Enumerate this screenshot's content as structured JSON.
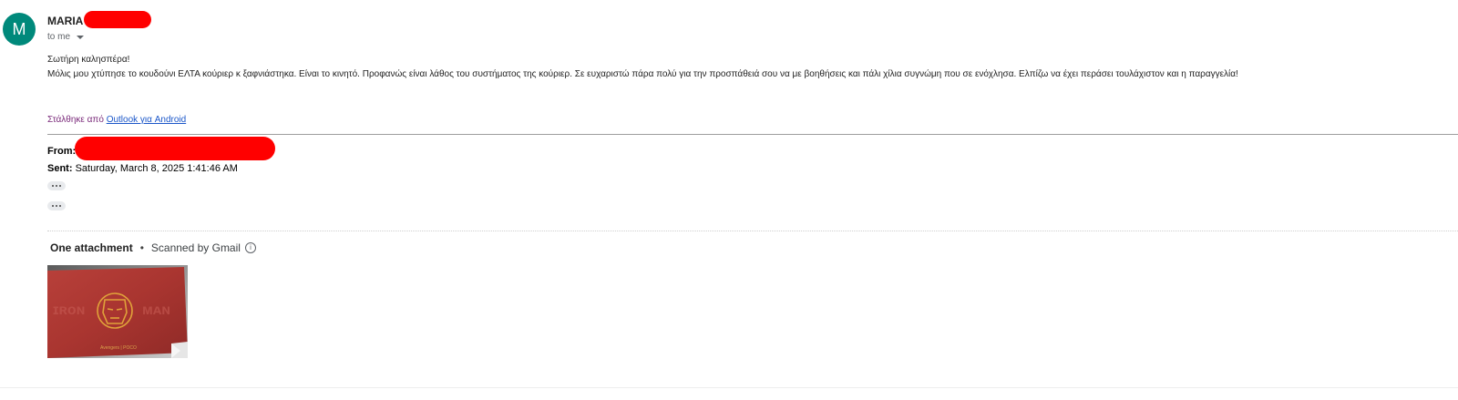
{
  "sender": {
    "avatar_letter": "M",
    "name": "MARIA",
    "to_label": "to me"
  },
  "message": {
    "greeting": "Σωτήρη καλησπέρα!",
    "body": "Μόλις μου χτύπησε το κουδούνι ΕΛΤΑ κούριερ κ ξαφνιάστηκα. Είναι το κινητό. Προφανώς είναι λάθος του συστήματος της κούριερ. Σε ευχαριστώ πάρα πολύ για την προσπάθειά σου να με βοηθήσεις και πάλι χίλια συγνώμη που σε ενόχλησα. Ελπίζω να έχει περάσει τουλάχιστον και η παραγγελία!",
    "signature_prefix": "Στάλθηκε από",
    "signature_link": "Outlook για Android"
  },
  "quoted": {
    "from_label": "From:",
    "sent_label": "Sent:",
    "sent_value": "Saturday, March 8, 2025 1:41:46 AM"
  },
  "attachments": {
    "title": "One attachment",
    "separator": "•",
    "scanned": "Scanned by Gmail",
    "info_icon": "info-icon"
  },
  "colors": {
    "avatar": "#00897b",
    "redaction": "#ff0000",
    "link": "#1a56c9",
    "signature": "#7a2a7a"
  }
}
